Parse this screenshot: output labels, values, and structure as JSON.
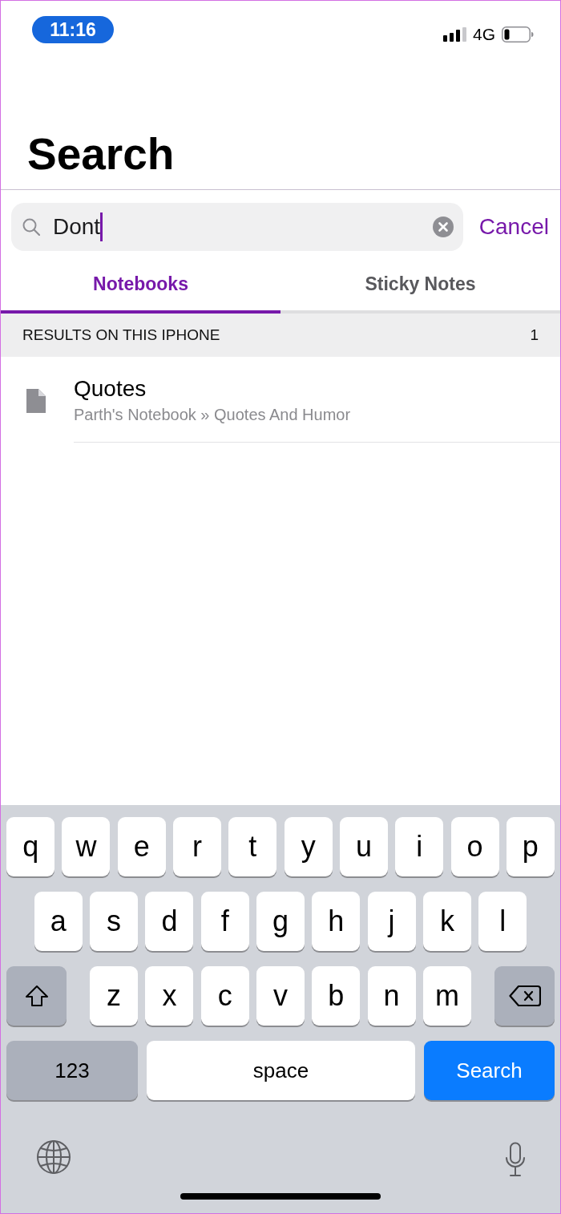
{
  "status_bar": {
    "time": "11:16",
    "network": "4G"
  },
  "header": {
    "title": "Search"
  },
  "search": {
    "value": "Dont",
    "focused": true,
    "cancel": "Cancel"
  },
  "tabs": [
    {
      "label": "Notebooks",
      "selected": true
    },
    {
      "label": "Sticky Notes",
      "selected": false
    }
  ],
  "results": {
    "section_title": "RESULTS ON THIS IPHONE",
    "count": "1",
    "items": [
      {
        "title": "Quotes",
        "path": "Parth's Notebook » Quotes And Humor"
      }
    ]
  },
  "keyboard": {
    "rows": [
      {
        "keys": [
          {
            "kind": "letter",
            "label": "q"
          },
          {
            "kind": "letter",
            "label": "w"
          },
          {
            "kind": "letter",
            "label": "e"
          },
          {
            "kind": "letter",
            "label": "r"
          },
          {
            "kind": "letter",
            "label": "t"
          },
          {
            "kind": "letter",
            "label": "y"
          },
          {
            "kind": "letter",
            "label": "u"
          },
          {
            "kind": "letter",
            "label": "i"
          },
          {
            "kind": "letter",
            "label": "o"
          },
          {
            "kind": "letter",
            "label": "p"
          }
        ]
      },
      {
        "keys": [
          {
            "kind": "letter",
            "label": "a"
          },
          {
            "kind": "letter",
            "label": "s"
          },
          {
            "kind": "letter",
            "label": "d"
          },
          {
            "kind": "letter",
            "label": "f"
          },
          {
            "kind": "letter",
            "label": "g"
          },
          {
            "kind": "letter",
            "label": "h"
          },
          {
            "kind": "letter",
            "label": "j"
          },
          {
            "kind": "letter",
            "label": "k"
          },
          {
            "kind": "letter",
            "label": "l"
          }
        ]
      },
      {
        "keys": [
          {
            "kind": "shift"
          },
          {
            "kind": "letter",
            "label": "z"
          },
          {
            "kind": "letter",
            "label": "x"
          },
          {
            "kind": "letter",
            "label": "c"
          },
          {
            "kind": "letter",
            "label": "v"
          },
          {
            "kind": "letter",
            "label": "b"
          },
          {
            "kind": "letter",
            "label": "n"
          },
          {
            "kind": "letter",
            "label": "m"
          },
          {
            "kind": "delete"
          }
        ]
      },
      {
        "keys": [
          {
            "kind": "mode",
            "label": "123"
          },
          {
            "kind": "space",
            "label": "space"
          },
          {
            "kind": "action",
            "label": "Search"
          }
        ]
      }
    ]
  }
}
